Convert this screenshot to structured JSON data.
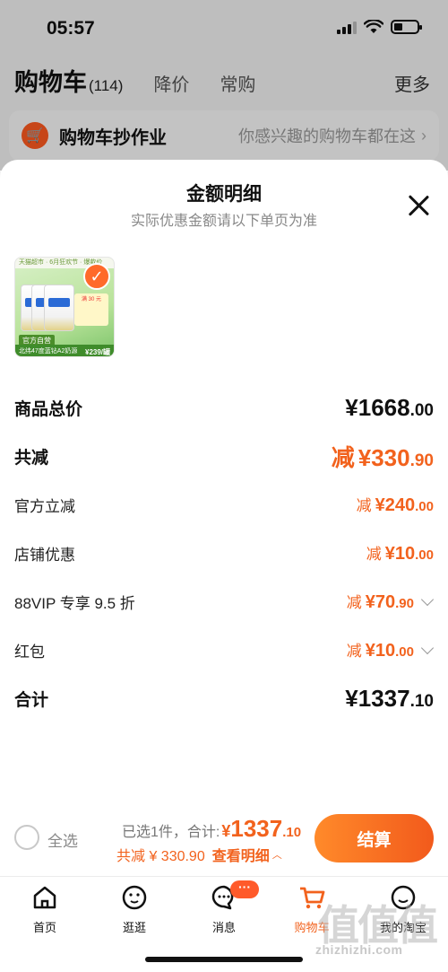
{
  "status_bar": {
    "time": "05:57"
  },
  "cart_header": {
    "title": "购物车",
    "count": "(114)",
    "tabs": [
      "降价",
      "常购"
    ],
    "more": "更多"
  },
  "homework_banner": {
    "title": "购物车抄作业",
    "subtitle": "你感兴趣的购物车都在这"
  },
  "sheet": {
    "title": "金额明细",
    "subtitle": "实际优惠金额请以下单页为准"
  },
  "product": {
    "top_strip": "天猫超市 · 6月狂欢节 · 爆款价",
    "promo": "满 30 元",
    "self_tag": "官方自营",
    "band": "北纬47度蓝钻A2奶源",
    "price_text": "¥239/罐"
  },
  "rows": [
    {
      "label": "商品总价",
      "prefix": "",
      "yen": "¥",
      "int": "1668",
      "dec": ".00",
      "kind": "total"
    },
    {
      "label": "共减",
      "prefix": "减",
      "yen": "¥",
      "int": "330",
      "dec": ".90",
      "kind": "reduce"
    },
    {
      "label": "官方立减",
      "prefix": "减",
      "yen": "¥",
      "int": "240",
      "dec": ".00",
      "kind": "sub"
    },
    {
      "label": "店铺优惠",
      "prefix": "减",
      "yen": "¥",
      "int": "10",
      "dec": ".00",
      "kind": "sub"
    },
    {
      "label": "88VIP 专享 9.5 折",
      "prefix": "减",
      "yen": "¥",
      "int": "70",
      "dec": ".90",
      "kind": "sub"
    },
    {
      "label": "红包",
      "prefix": "减",
      "yen": "¥",
      "int": "10",
      "dec": ".00",
      "kind": "sub"
    },
    {
      "label": "合计",
      "prefix": "",
      "yen": "¥",
      "int": "1337",
      "dec": ".10",
      "kind": "sum"
    }
  ],
  "checkout": {
    "select_all": "全选",
    "selected_info": "已选1件，合计:",
    "yen": "¥",
    "total_int": "1337",
    "total_dec": ".10",
    "reduce_text": "共减 ¥ 330.90",
    "detail_link": "查看明细",
    "pay_label": "结算"
  },
  "tabbar": {
    "items": [
      {
        "label": "首页",
        "icon": "home-icon"
      },
      {
        "label": "逛逛",
        "icon": "explore-icon"
      },
      {
        "label": "消息",
        "icon": "message-icon",
        "badge": "···"
      },
      {
        "label": "购物车",
        "icon": "cart-icon",
        "active": true
      },
      {
        "label": "我的淘宝",
        "icon": "profile-icon"
      }
    ]
  },
  "watermark": {
    "text": "zhizhizhi.com",
    "mark": "值值值"
  },
  "colors": {
    "accent": "#f2621d",
    "pay_gradient_start": "#ff8a2a",
    "pay_gradient_end": "#f25a1c"
  }
}
